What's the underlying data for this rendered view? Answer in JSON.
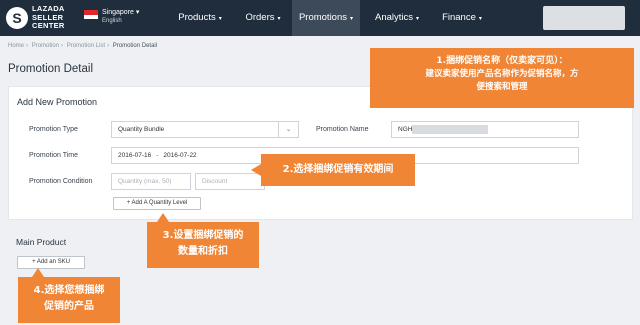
{
  "header": {
    "logo_line1": "LAZADA",
    "logo_line2": "SELLER",
    "logo_line3": "CENTER",
    "logo_letter": "S",
    "country": "Singapore",
    "language": "English",
    "nav": [
      {
        "label": "Products",
        "active": false
      },
      {
        "label": "Orders",
        "active": false
      },
      {
        "label": "Promotions",
        "active": true
      },
      {
        "label": "Analytics",
        "active": false
      },
      {
        "label": "Finance",
        "active": false
      }
    ],
    "caret": "▾"
  },
  "breadcrumb": [
    "Home",
    "Promotion",
    "Promotion List",
    "Promotion Detail"
  ],
  "breadcrumb_sep": "›",
  "page_title": "Promotion Detail",
  "form": {
    "card_title": "Add New Promotion",
    "promotion_type_label": "Promotion Type",
    "promotion_type_value": "Quantity Bundle",
    "promotion_name_label": "Promotion Name",
    "promotion_name_value": "NGHS",
    "promotion_time_label": "Promotion Time",
    "start_date": "2016-07-16",
    "date_sep": "-",
    "end_date": "2016-07-22",
    "promotion_condition_label": "Promotion Condition",
    "quantity_placeholder": "Quantity (max. 50)",
    "discount_placeholder": "Discount",
    "add_quantity_level_label": "+ Add A Quantity Level"
  },
  "main_product": {
    "title": "Main Product",
    "add_sku_label": "+ Add an SKU"
  },
  "callouts": {
    "c1_line1": "1.捆绑促销名称（仅卖家可见）：",
    "c1_line2": "建议卖家使用产品名称作为促销名称，方",
    "c1_line3": "便搜索和管理",
    "c2": "2.选择捆绑促销有效期间",
    "c3_line1": "3.设置捆绑促销的",
    "c3_line2": "数量和折扣",
    "c4_line1": "4.选择您想捆绑",
    "c4_line2": "促销的产品"
  },
  "colors": {
    "nav_bg": "#1f2d3d",
    "nav_active": "#3c4a5a",
    "callout": "#f08535"
  }
}
